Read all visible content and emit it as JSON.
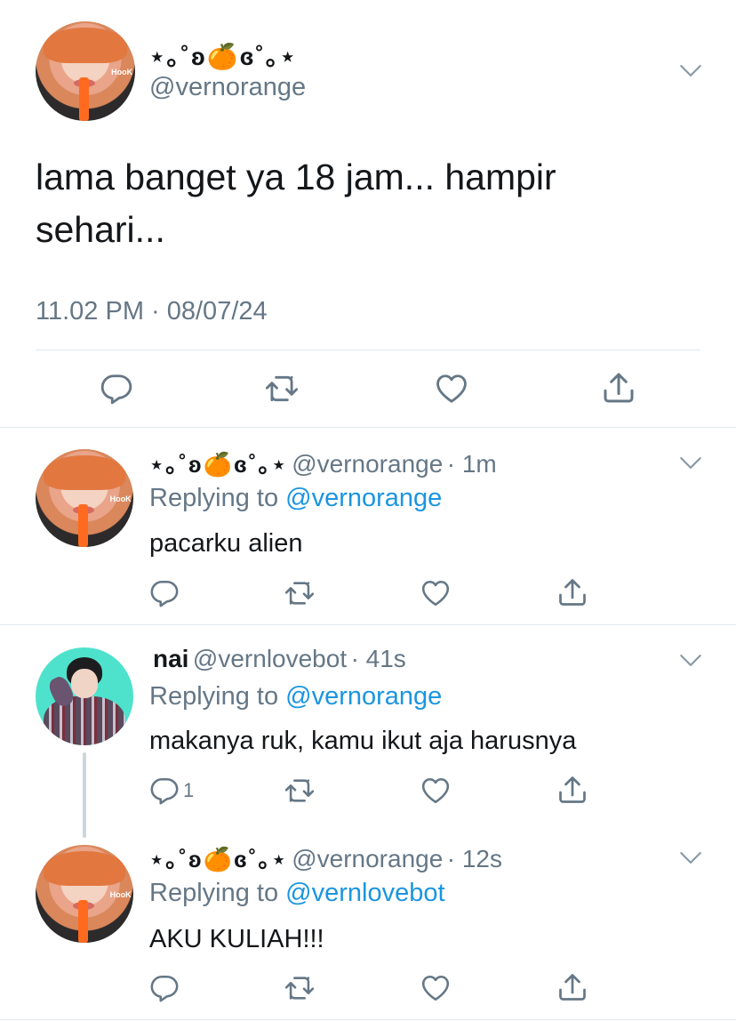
{
  "main_tweet": {
    "display_name": "⋆｡˚ʚ🍊ɞ˚｡⋆",
    "handle": "@vernorange",
    "text_line1": "lama banget ya 18 jam... hampir",
    "text_line2": "sehari...",
    "timestamp": "11.02 PM · 08/07/24",
    "avatar_icon": "user-avatar-orange-hair"
  },
  "replies": [
    {
      "display_name": "⋆｡˚ʚ🍊ɞ˚｡⋆",
      "handle": "@vernorange",
      "time": "· 1m",
      "replying_prefix": "Replying to",
      "replying_to": "@vernorange",
      "text": "pacarku alien",
      "reply_count": ""
    },
    {
      "display_name": "nai",
      "handle": "@vernlovebot",
      "time": "· 41s",
      "replying_prefix": "Replying to",
      "replying_to": "@vernorange",
      "text": "makanya ruk, kamu ikut aja harusnya",
      "reply_count": "1"
    },
    {
      "display_name": "⋆｡˚ʚ🍊ɞ˚｡⋆",
      "handle": "@vernorange",
      "time": "· 12s",
      "replying_prefix": "Replying to",
      "replying_to": "@vernlovebot",
      "text": "AKU KULIAH!!!",
      "reply_count": ""
    }
  ],
  "colors": {
    "link_blue": "#1b95e0",
    "muted_gray": "#657786",
    "divider": "#e1e8ed",
    "text": "#14171a"
  },
  "icons": [
    "chevron-down-icon",
    "reply-icon",
    "retweet-icon",
    "like-icon",
    "share-icon"
  ]
}
